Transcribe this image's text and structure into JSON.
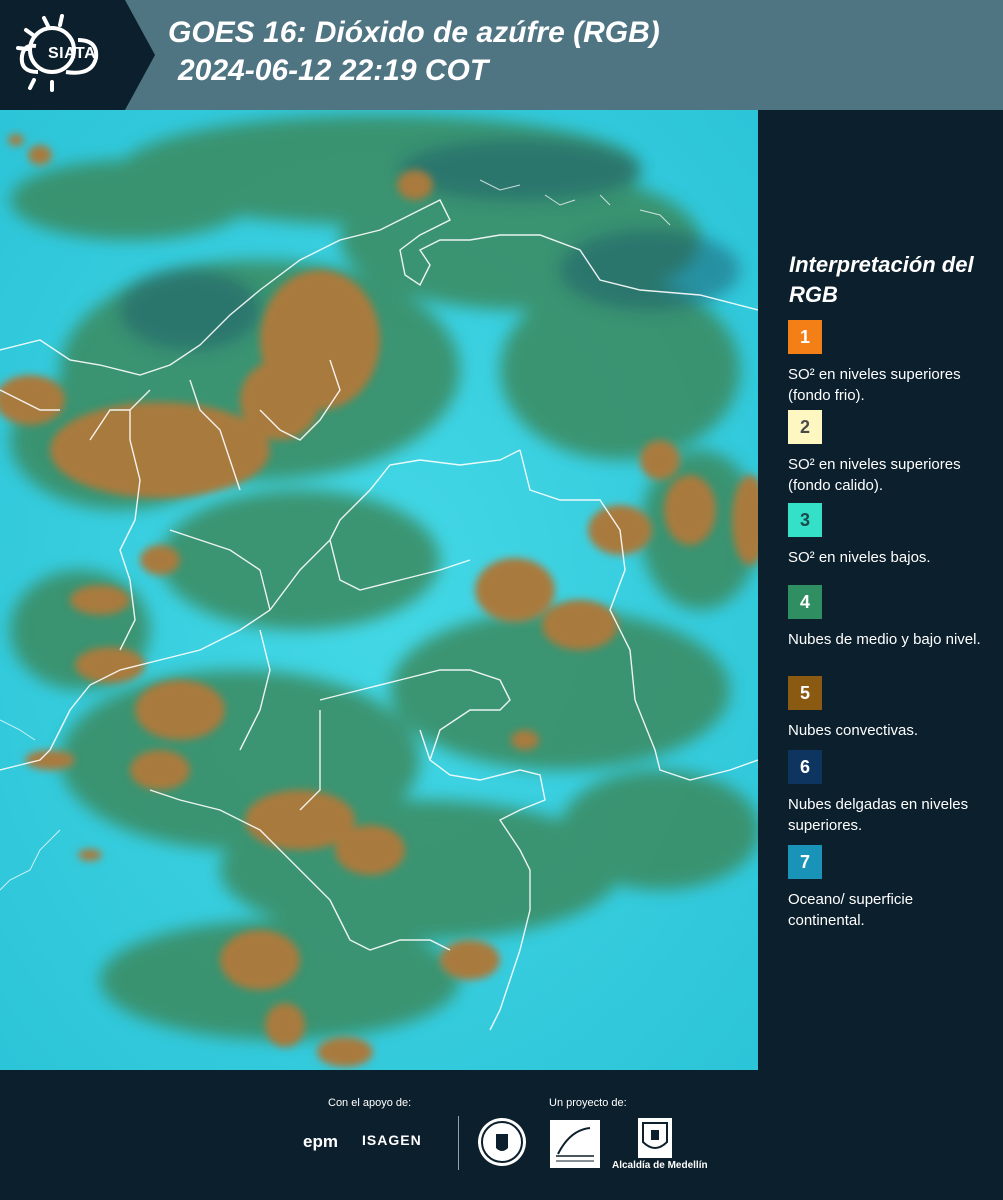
{
  "header": {
    "logo_text": "SIATA",
    "title_line1": "GOES 16: Dióxido de azúfre (RGB)",
    "title_line2": "2024-06-12 22:19 COT",
    "background_color": "#4f7583"
  },
  "legend": {
    "title": "Interpretación del RGB",
    "items": [
      {
        "number": "1",
        "label": "SO² en niveles superiores (fondo frio).",
        "color": "#f57f17",
        "number_color": "#ffffff"
      },
      {
        "number": "2",
        "label": "SO² en niveles superiores (fondo calido).",
        "color": "#fff7c2",
        "number_color": "#4a4a4a"
      },
      {
        "number": "3",
        "label": "SO² en niveles bajos.",
        "color": "#35e0c9",
        "number_color": "#1a4a4a"
      },
      {
        "number": "4",
        "label": "Nubes de medio y bajo nivel.",
        "color": "#2f8f63",
        "number_color": "#ffffff"
      },
      {
        "number": "5",
        "label": "Nubes convectivas.",
        "color": "#8a5a12",
        "number_color": "#ffffff"
      },
      {
        "number": "6",
        "label": "Nubes delgadas en niveles superiores.",
        "color": "#0e3560",
        "number_color": "#ffffff"
      },
      {
        "number": "7",
        "label": "Oceano/ superficie continental.",
        "color": "#1a93b8",
        "number_color": "#ffffff"
      }
    ]
  },
  "map": {
    "background_color": "#36cfe0",
    "convective_cloud_color": "#a97a3c",
    "low_cloud_color": "#3a8a5e",
    "border_color": "#ffffff"
  },
  "footer": {
    "support_label": "Con el apoyo de:",
    "project_label": "Un proyecto de:",
    "sponsors": [
      "epm",
      "ISAGEN"
    ],
    "partners": [
      "Área Metropolitana Valle de Aburrá",
      "Alcaldía de Medellín"
    ],
    "alcaldia_label": "Alcaldía de Medellín"
  }
}
